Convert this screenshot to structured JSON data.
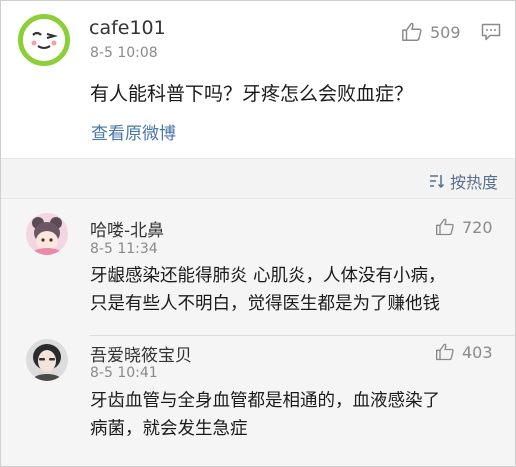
{
  "main_comment": {
    "username": "cafe101",
    "time": "8-5 10:08",
    "likes": "509",
    "text": "有人能科普下吗？牙疼怎么会败血症？",
    "view_original": "查看原微博"
  },
  "sort": {
    "label": "按热度"
  },
  "replies": [
    {
      "username": "哈喽-北鼻",
      "time": "8-5 11:34",
      "likes": "720",
      "lines": [
        "牙龈感染还能得肺炎 心肌炎，人体没有小病，",
        "只是有些人不明白，觉得医生都是为了赚他钱"
      ]
    },
    {
      "username": "吾爱晓筱宝贝",
      "time": "8-5 10:41",
      "likes": "403",
      "lines": [
        "牙齿血管与全身血管都是相通的，血液感染了",
        "病菌，就会发生急症"
      ]
    }
  ],
  "colors": {
    "accent_link": "#4a76a8",
    "avatar_ring": "#8ccf3a",
    "reply_bg": "#f5f5f5"
  }
}
